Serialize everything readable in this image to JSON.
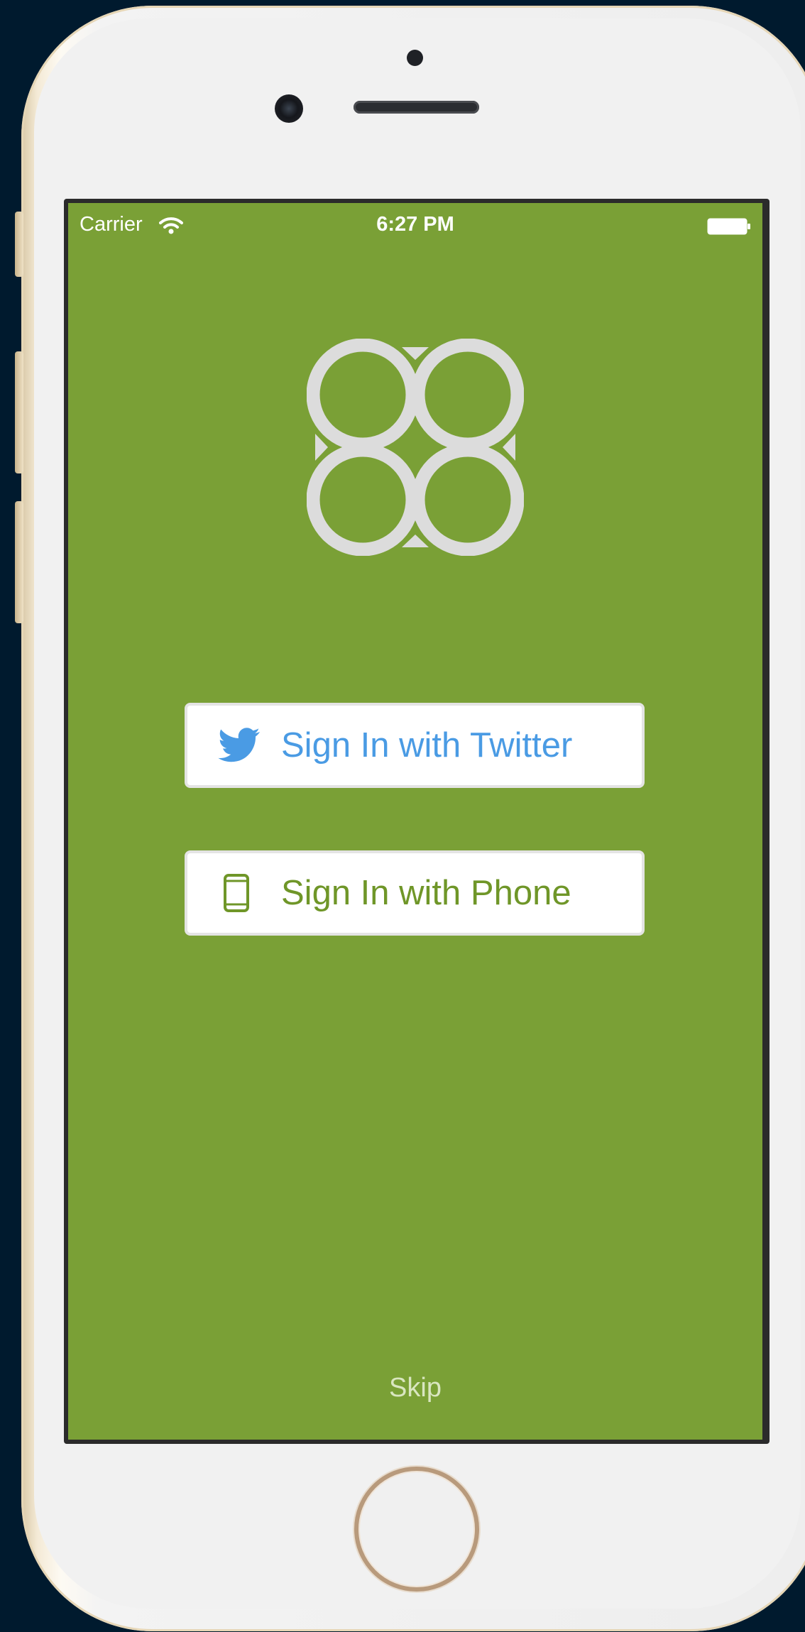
{
  "status_bar": {
    "carrier": "Carrier",
    "time": "6:27 PM",
    "wifi_icon": "wifi-icon",
    "battery_icon": "battery-full-icon"
  },
  "logo": {
    "icon": "four-circles-logo-icon",
    "color": "#dcdcdc"
  },
  "buttons": {
    "twitter": {
      "label": "Sign In with Twitter",
      "icon": "twitter-bird-icon",
      "color": "#4a9be4"
    },
    "phone": {
      "label": "Sign In with Phone",
      "icon": "mobile-phone-icon",
      "color": "#6f9628"
    }
  },
  "skip_label": "Skip",
  "colors": {
    "background": "#7aa036",
    "button_background": "#ffffff"
  }
}
